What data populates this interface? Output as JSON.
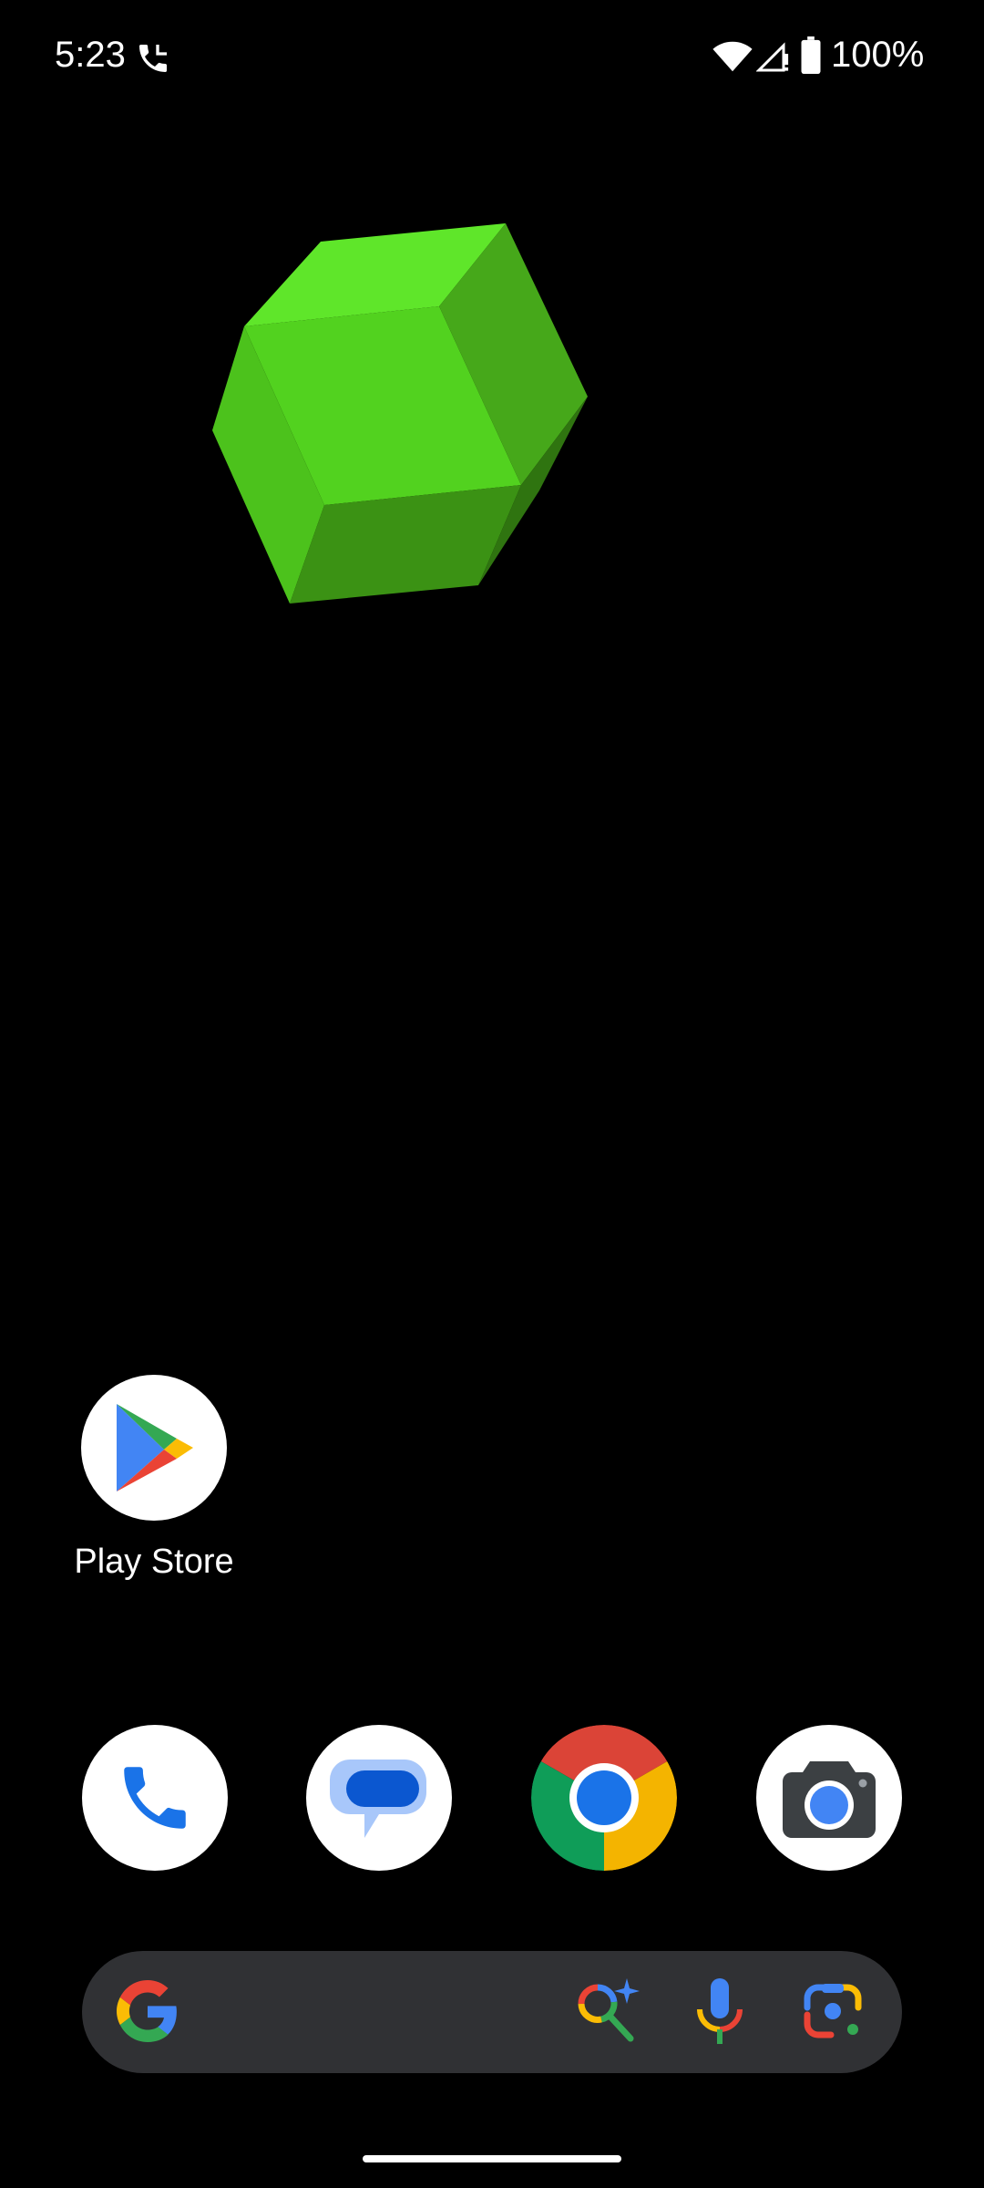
{
  "status_bar": {
    "time": "5:23",
    "battery": "100%",
    "icons": [
      "phone-call-icon",
      "wifi-icon",
      "cell-signal-icon",
      "battery-icon"
    ]
  },
  "wallpaper": {
    "shape": "green-rhombic-dodecahedron",
    "colors": [
      "#5fe62a",
      "#4fc91e",
      "#3a8f14",
      "#2f6e10"
    ]
  },
  "home_apps": [
    {
      "label": "Play Store",
      "icon": "play-store-icon"
    }
  ],
  "dock": [
    {
      "name": "Phone",
      "icon": "phone-icon"
    },
    {
      "name": "Messages",
      "icon": "messages-icon"
    },
    {
      "name": "Chrome",
      "icon": "chrome-icon"
    },
    {
      "name": "Camera",
      "icon": "camera-icon"
    }
  ],
  "search_bar": {
    "icons": [
      "google-g-icon",
      "lens-search-icon",
      "mic-icon",
      "lens-camera-icon"
    ]
  },
  "colors": {
    "background": "#000000",
    "search_bar_bg": "#303134",
    "google_blue": "#4285F4",
    "google_red": "#EA4335",
    "google_yellow": "#FBBC05",
    "google_green": "#34A853"
  }
}
